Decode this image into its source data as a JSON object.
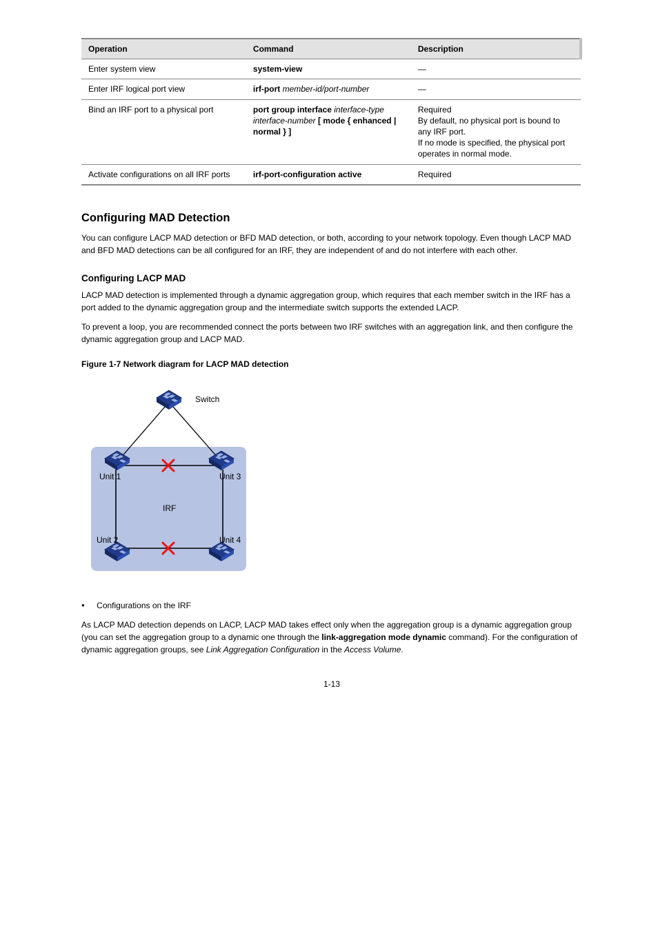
{
  "table": {
    "headers": [
      "Operation",
      "Command",
      "Description"
    ],
    "rows": [
      {
        "op": "Enter system view",
        "cmd": "system-view",
        "desc": "—"
      },
      {
        "op": "Enter IRF logical port view",
        "cmd_pre": "irf-port",
        "cmd_arg": " member-id/port-number",
        "desc": "—"
      },
      {
        "op": "Bind an IRF port to a physical port",
        "cmd_pre": "port group interface",
        "cmd_arg": " interface-type interface-number ",
        "cmd_tail": "[ mode { enhanced | normal } ]",
        "desc": "Required\nBy default, no physical port is bound to any IRF port.\nIf no mode is specified, the physical port operates in normal mode."
      },
      {
        "op": "Activate configurations on all IRF ports",
        "cmd": "irf-port-configuration active",
        "desc": "Required"
      }
    ]
  },
  "sect_mad": "Configuring MAD Detection",
  "mad_body": "You can configure LACP MAD detection or BFD MAD detection, or both, according to your network topology. Even though LACP MAD and BFD MAD detections can be all configured for an IRF, they are independent of and do not interfere with each other.",
  "sect_lacp": "Configuring LACP MAD",
  "lacp_body": [
    "LACP MAD detection is implemented through a dynamic aggregation group, which requires that each member switch in the IRF has a port added to the dynamic aggregation group and the intermediate switch supports the extended LACP.",
    "To prevent a loop, you are recommended connect the ports between two IRF switches with an aggregation link, and then configure the dynamic aggregation group and LACP MAD."
  ],
  "figcap": "Figure 1-7 Network diagram for LACP MAD detection",
  "figure": {
    "labels": {
      "switch": "Switch",
      "u1": "Unit 1",
      "u2": "Unit 2",
      "u3": "Unit 3",
      "u4": "Unit 4",
      "irf": "IRF"
    }
  },
  "bullets": [
    "Configurations on the IRF"
  ],
  "post_fig": "As LACP MAD detection depends on LACP, LACP MAD takes effect only when the aggregation group is a dynamic aggregation group (you can set the aggregation group to a dynamic one through the link-aggregation mode dynamic command). For the configuration of dynamic aggregation groups, see Link Aggregation Configuration in the Access Volume.",
  "page_number": "1-13"
}
